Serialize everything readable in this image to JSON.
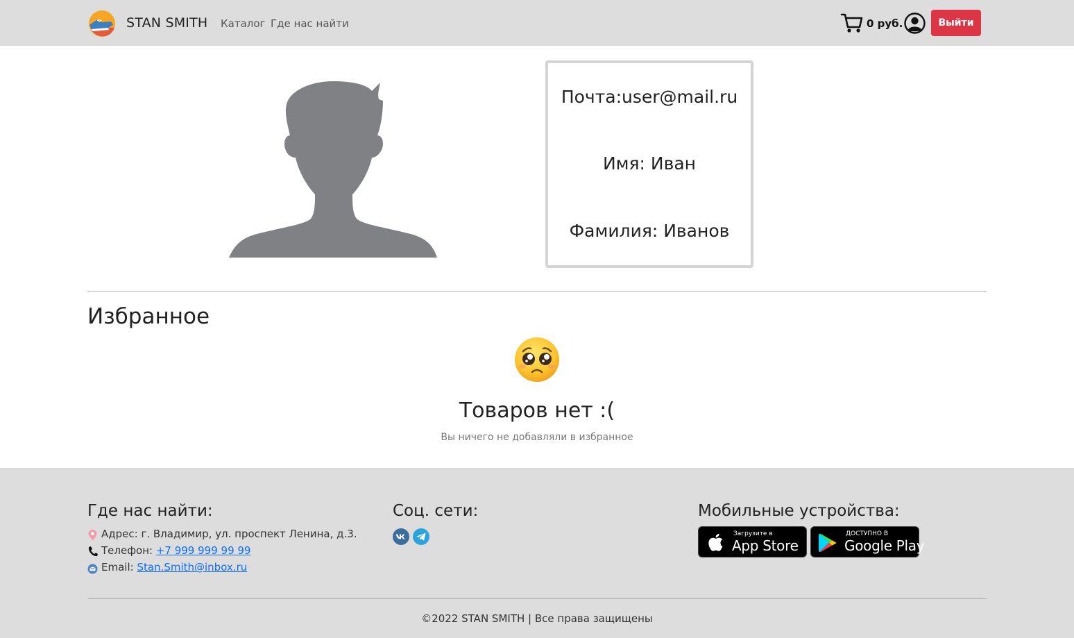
{
  "header": {
    "brand": "STAN SMITH",
    "nav": [
      {
        "label": "Каталог"
      },
      {
        "label": "Где нас найти"
      }
    ],
    "cart_price": "0 руб.",
    "logout_label": "Выйти"
  },
  "profile": {
    "email_line": "Почта:user@mail.ru",
    "name_line": "Имя: Иван",
    "surname_line": "Фамилия: Иванов"
  },
  "favorites": {
    "title": "Избранное",
    "empty_title": "Товаров нет :(",
    "empty_subtitle": "Вы ничего не добавляли в избранное"
  },
  "footer": {
    "find_us": {
      "title": "Где нас найти:",
      "address": "Адрес: г. Владимир, ул. проспект Ленина, д.3.",
      "phone_label": "Телефон: ",
      "phone": "+7 999 999 99 99",
      "email_label": "Email: ",
      "email": "Stan.Smith@inbox.ru"
    },
    "social": {
      "title": "Соц. сети:",
      "icons": [
        "vk-icon",
        "telegram-icon"
      ]
    },
    "mobile": {
      "title": "Мобильные устройства:",
      "app_store_small": "Загрузите в",
      "app_store_big": "App Store",
      "google_play_small": "ДОСТУПНО В",
      "google_play_big": "Google Play"
    },
    "copyright": "©2022 STAN SMITH | Все права защищены"
  },
  "colors": {
    "header_bg": "#dddddd",
    "logout_red": "#dc3545",
    "link_blue": "#0d6efd",
    "avatar_gray": "#808185"
  }
}
